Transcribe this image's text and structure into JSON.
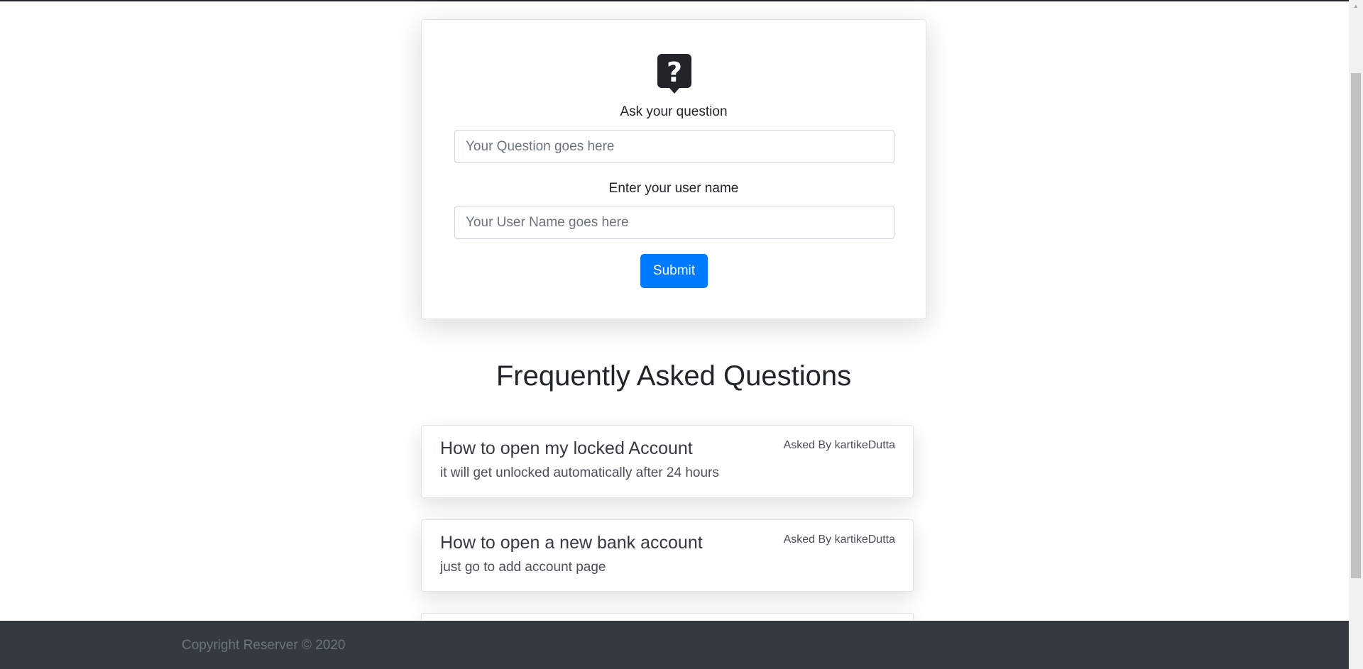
{
  "ask_form": {
    "icon": "question-bubble-icon",
    "question_label": "Ask your question",
    "question_placeholder": "Your Question goes here",
    "question_value": "",
    "username_label": "Enter your user name",
    "username_placeholder": "Your User Name goes here",
    "username_value": "",
    "submit_label": "Submit"
  },
  "faq": {
    "title": "Frequently Asked Questions",
    "items": [
      {
        "question": "How to open my locked Account",
        "answer": "it will get unlocked automatically after 24 hours",
        "asked_by": "Asked By kartikeDutta"
      },
      {
        "question": "How to open a new bank account",
        "answer": "just go to add account page",
        "asked_by": "Asked By kartikeDutta"
      }
    ]
  },
  "footer": {
    "copyright": "Copyright Reserver © 2020"
  },
  "colors": {
    "primary": "#007bff",
    "footer_bg": "#343a40",
    "text": "#212529"
  }
}
